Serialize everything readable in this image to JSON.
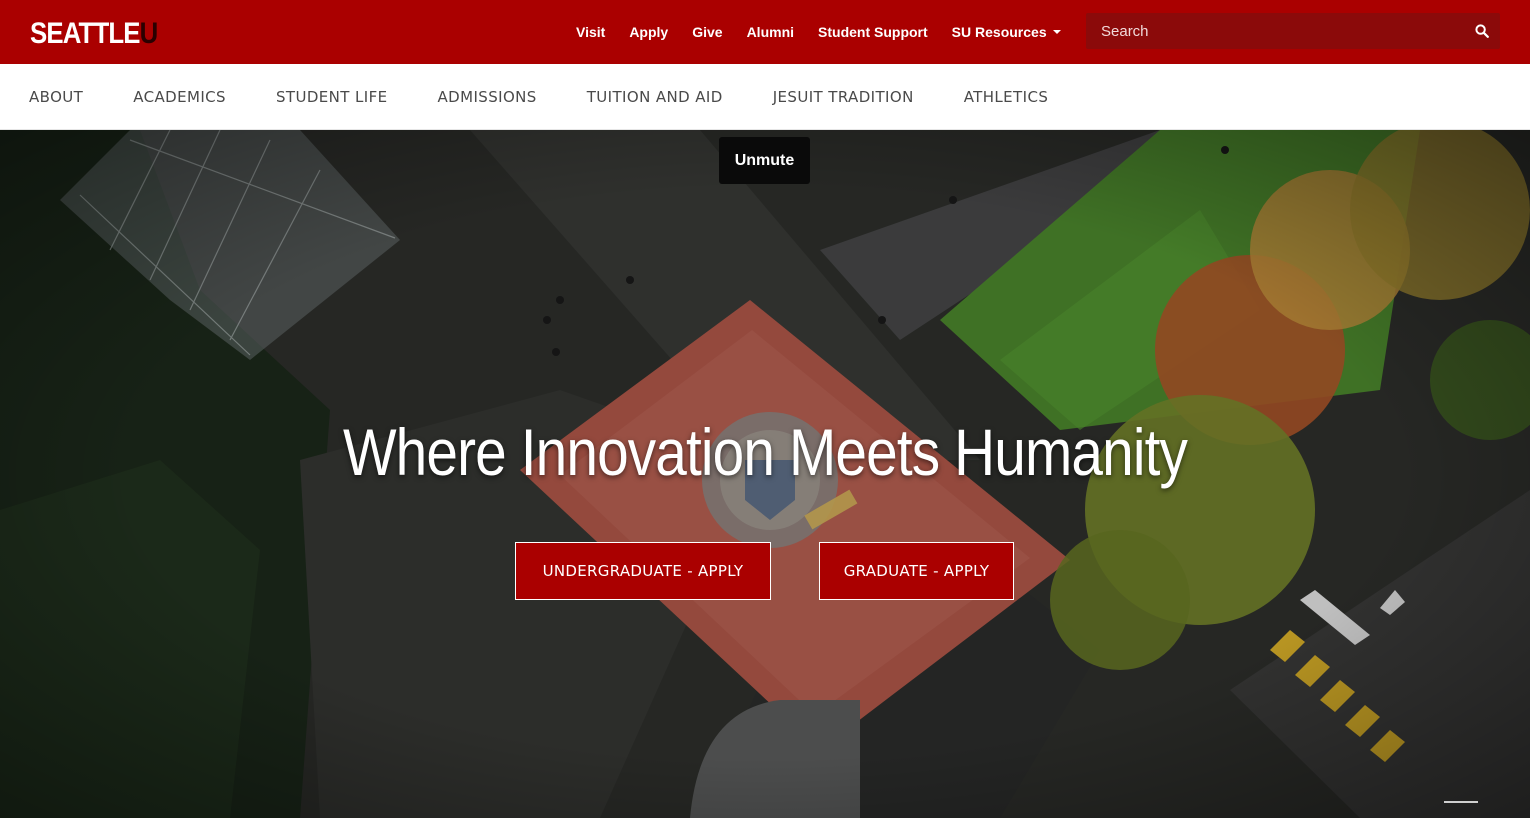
{
  "brand": {
    "logo_text_main": "SEATTLE",
    "logo_text_u": "U",
    "primary_color": "#aa0000",
    "search_bg": "#8b0a0a"
  },
  "utility_nav": {
    "items": [
      "Visit",
      "Apply",
      "Give",
      "Alumni",
      "Student Support"
    ],
    "resources_label": "SU Resources"
  },
  "search": {
    "placeholder": "Search",
    "value": ""
  },
  "main_nav": {
    "items": [
      "ABOUT",
      "ACADEMICS",
      "STUDENT LIFE",
      "ADMISSIONS",
      "TUITION AND AID",
      "JESUIT TRADITION",
      "ATHLETICS"
    ]
  },
  "hero": {
    "unmute_label": "Unmute",
    "headline": "Where Innovation Meets Humanity",
    "cta_undergrad": "UNDERGRADUATE - APPLY",
    "cta_graduate": "GRADUATE - APPLY",
    "background": "aerial-campus-video"
  },
  "icons": {
    "search": "search-icon",
    "dropdown": "chevron-down-icon"
  }
}
